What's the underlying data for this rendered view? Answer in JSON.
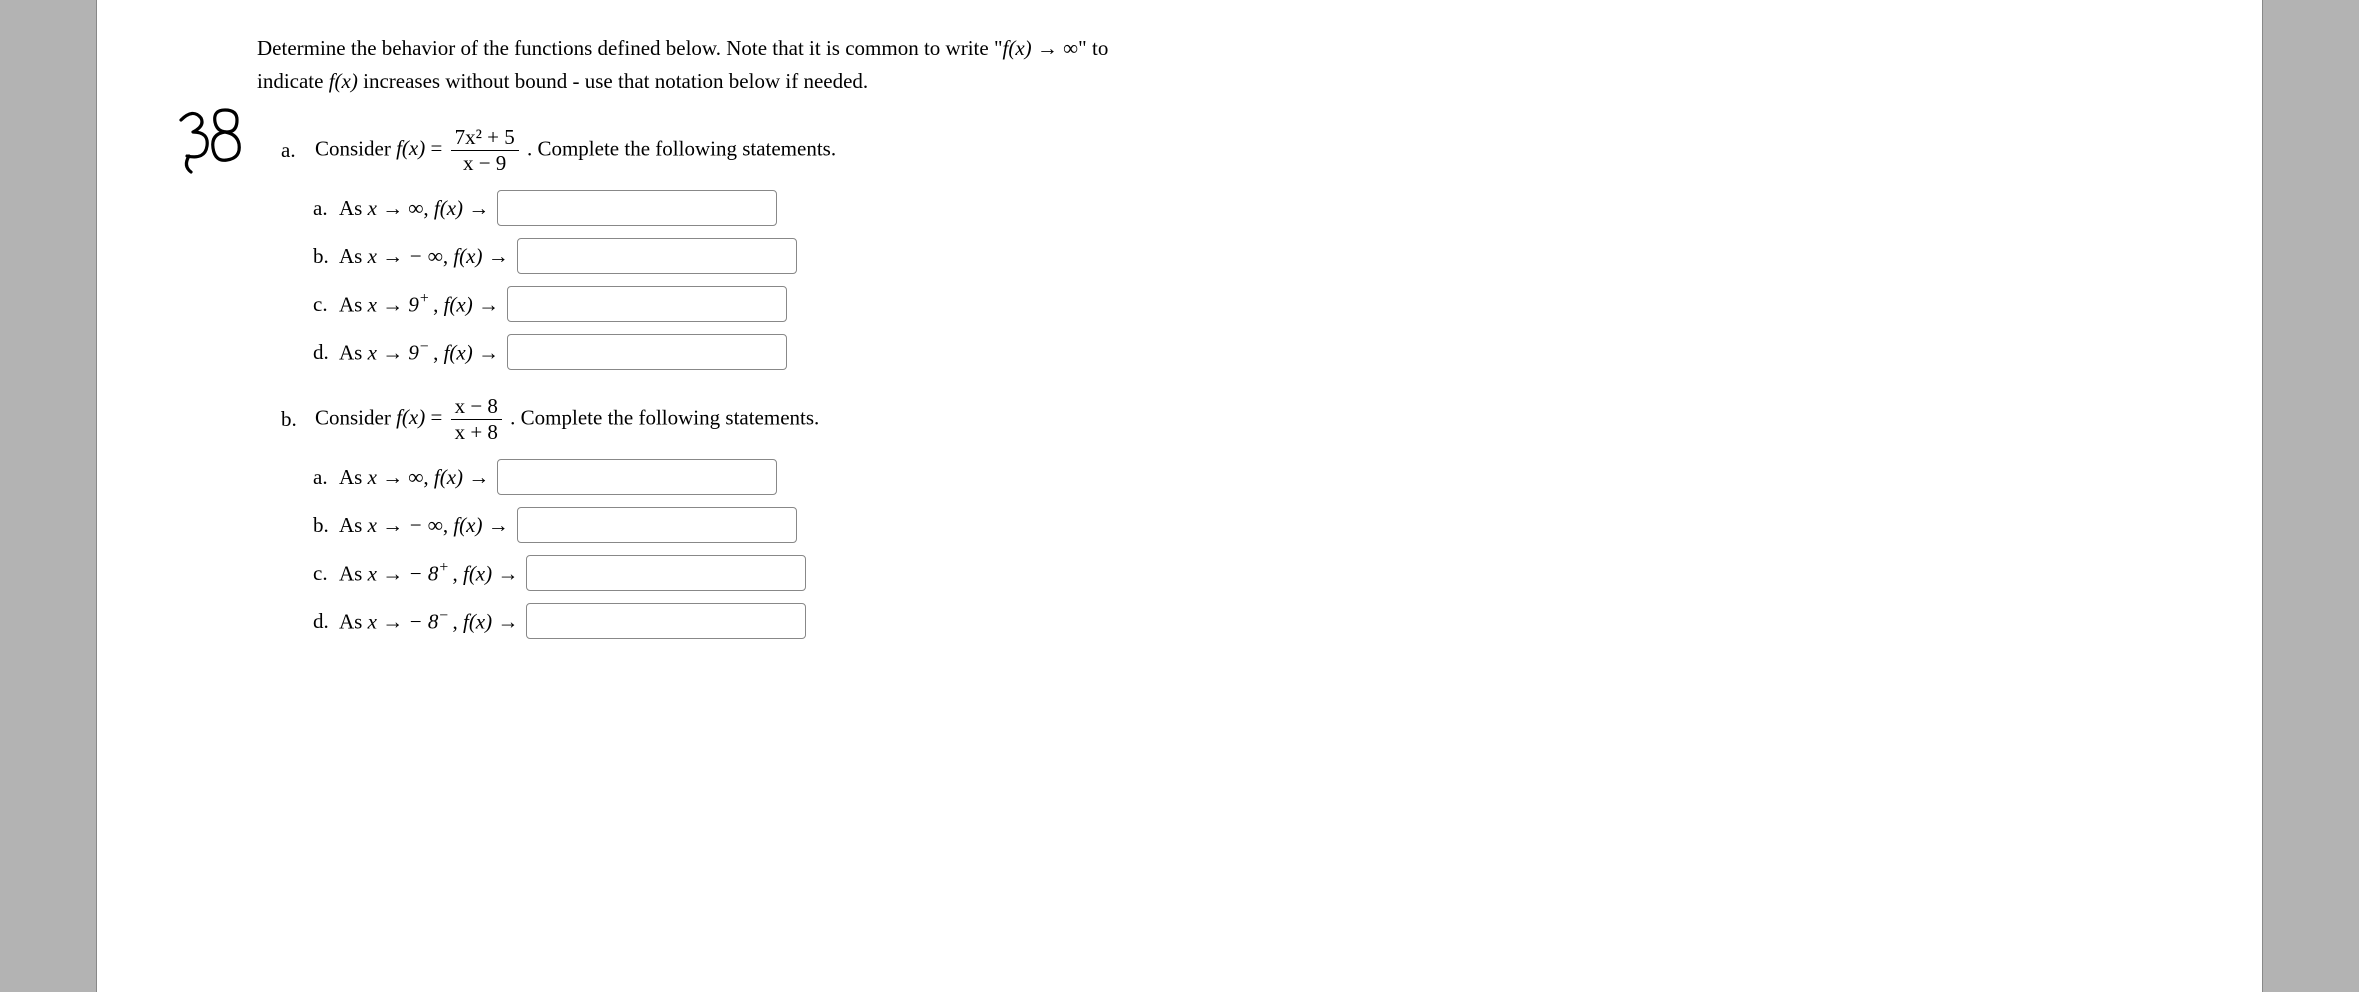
{
  "intro": {
    "line1_a": "Determine the behavior of the functions defined below. Note that it is common to write \"",
    "line1_b": "\" to",
    "line2_a": "indicate ",
    "line2_b": " increases without bound - use that notation below if needed."
  },
  "intro_math": {
    "fx": "f(x)",
    "arrow": "→",
    "inf": "∞"
  },
  "parts": {
    "a": {
      "label": "a.",
      "lead": "Consider ",
      "func": {
        "lhs": "f(x)",
        "eq": "=",
        "num": "7x² + 5",
        "den": "x − 9"
      },
      "tail": ". Complete the following statements.",
      "subs": [
        {
          "label": "a.",
          "text_pre": "As ",
          "limit": "x → ∞",
          "text_mid": ", ",
          "fx": "f(x) →"
        },
        {
          "label": "b.",
          "text_pre": "As ",
          "limit": "x →  − ∞",
          "text_mid": ", ",
          "fx": "f(x) →"
        },
        {
          "label": "c.",
          "text_pre": "As ",
          "limit": "x → 9",
          "sup": "+",
          "text_mid": " , ",
          "fx": "f(x) →"
        },
        {
          "label": "d.",
          "text_pre": "As ",
          "limit": "x → 9",
          "sup": "−",
          "text_mid": " , ",
          "fx": "f(x) →"
        }
      ]
    },
    "b": {
      "label": "b.",
      "lead": "Consider ",
      "func": {
        "lhs": "f(x)",
        "eq": "=",
        "num": "x − 8",
        "den": "x + 8"
      },
      "tail": ". Complete the following statements.",
      "subs": [
        {
          "label": "a.",
          "text_pre": "As ",
          "limit": "x → ∞",
          "text_mid": ", ",
          "fx": "f(x) →"
        },
        {
          "label": "b.",
          "text_pre": "As ",
          "limit": "x →  − ∞",
          "text_mid": ", ",
          "fx": "f(x) →"
        },
        {
          "label": "c.",
          "text_pre": "As ",
          "limit": "x →  − 8",
          "sup": "+",
          "text_mid": " , ",
          "fx": "f(x) →"
        },
        {
          "label": "d.",
          "text_pre": "As ",
          "limit": "x →  − 8",
          "sup": "−",
          "text_mid": " , ",
          "fx": "f(x) →"
        }
      ]
    }
  },
  "annotation_label": "38"
}
